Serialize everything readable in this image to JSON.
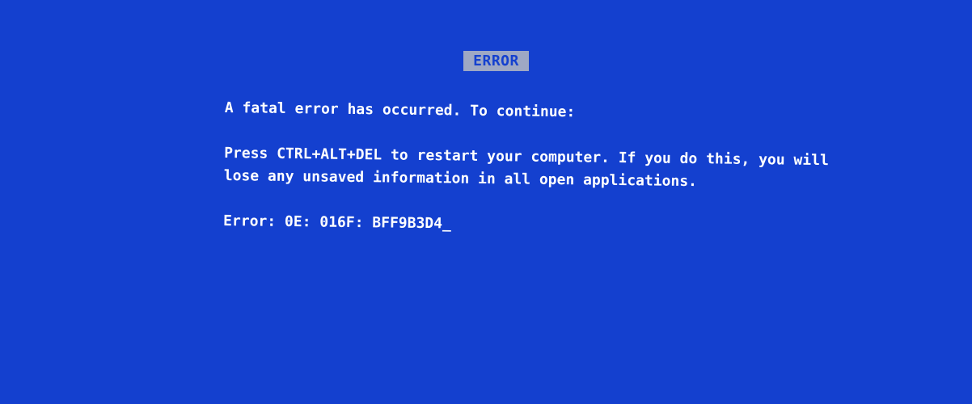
{
  "screen": {
    "background_color": "#1440cf",
    "title": "ERROR",
    "title_badge_color": "#9ea8c4",
    "message_line_1": "A fatal error has occurred. To continue:",
    "message_line_2": "Press CTRL+ALT+DEL to restart your computer. If you do this, you will",
    "message_line_3": "lose any unsaved information in all open applications.",
    "error_code": "Error: 0E: 016F: BFF9B3D4",
    "cursor": "_"
  }
}
